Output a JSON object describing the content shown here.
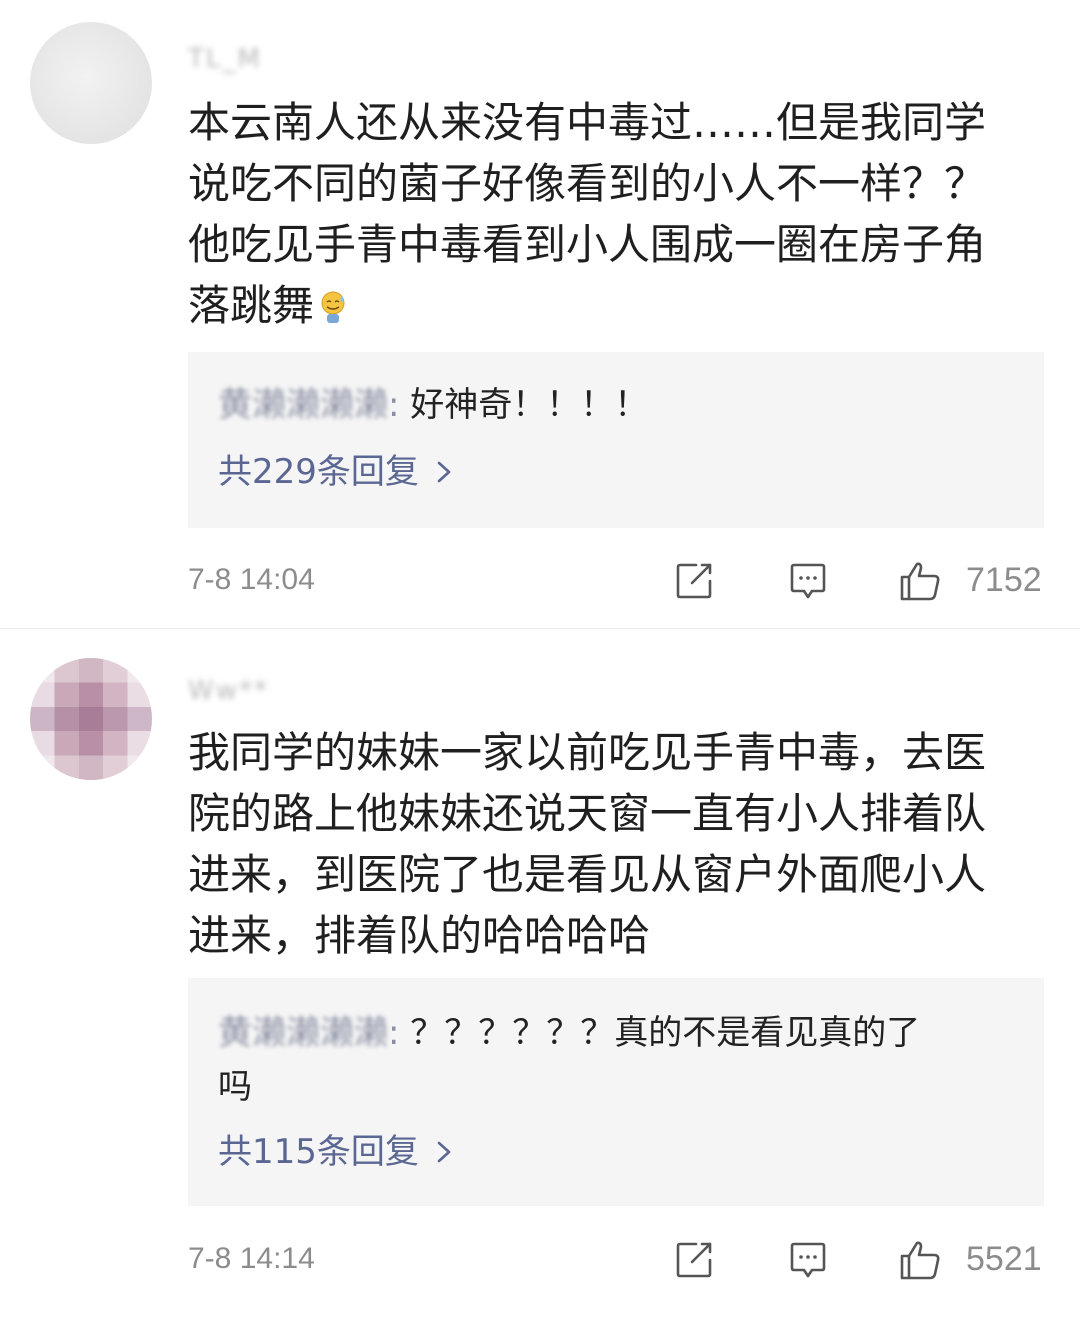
{
  "comments": [
    {
      "username": "TL_M",
      "text_lines": [
        "本云南人还从来没有中毒过……但是我同学",
        "说吃不同的菌子好像看到的小人不一样？？",
        "他吃见手青中毒看到小人围成一圈在房子角",
        "落跳舞"
      ],
      "emoji": "sweat-smile-emoji",
      "reply": {
        "author": "黄濑濑濑濑",
        "text_lines": [
          "好神奇！！！！"
        ],
        "more_label": "共229条回复"
      },
      "timestamp": "7-8 14:04",
      "likes": "7152"
    },
    {
      "username": "Ww**",
      "text_lines": [
        "我同学的妹妹一家以前吃见手青中毒，去医",
        "院的路上他妹妹还说天窗一直有小人排着队",
        "进来，到医院了也是看见从窗户外面爬小人",
        "进来，排着队的哈哈哈哈"
      ],
      "reply": {
        "author": "黄濑濑濑濑",
        "text_lines": [
          "？？？？？？真的不是看见真的了",
          "吗"
        ],
        "more_label": "共115条回复"
      },
      "timestamp": "7-8 14:14",
      "likes": "5521"
    }
  ],
  "icons": {
    "share": "share-icon",
    "comment": "comment-icon",
    "like": "thumbs-up-icon",
    "chevron": "chevron-right-icon"
  },
  "colors": {
    "reply_link": "#5a6792",
    "muted": "#8c8c8c",
    "reply_bg": "#f5f5f5",
    "username_blur": "#b9b9b9"
  }
}
